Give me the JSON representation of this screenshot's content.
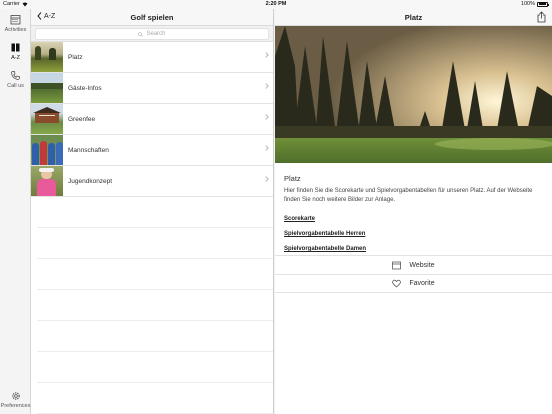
{
  "status_bar": {
    "carrier": "Carrier",
    "time": "2:20 PM",
    "battery": "100%"
  },
  "rail": {
    "items": [
      {
        "label": "Activities",
        "icon": "calendar-icon"
      },
      {
        "label": "A-Z",
        "icon": "book-icon"
      },
      {
        "label": "Call us",
        "icon": "phone-icon"
      }
    ],
    "bottom": {
      "label": "Preferences",
      "icon": "gear-icon"
    }
  },
  "list_pane": {
    "back_label": "A-Z",
    "title": "Golf spielen",
    "search_placeholder": "Search",
    "items": [
      {
        "label": "Platz"
      },
      {
        "label": "Gäste-Infos"
      },
      {
        "label": "Greenfee"
      },
      {
        "label": "Mannschaften"
      },
      {
        "label": "Jugendkonzept"
      }
    ]
  },
  "detail": {
    "title": "Platz",
    "heading": "Platz",
    "body": "Hier finden Sie die Scorekarte und Spielvorgabentabellen für unseren Platz. Auf der Webseite finden Sie noch weitere Bilder zur Anlage.",
    "links": [
      "Scorekarte",
      "Spielvorgabentabelle Herren",
      "Spielvorgabentabelle Damen"
    ],
    "actions": [
      {
        "label": "Website",
        "icon": "calendar-icon"
      },
      {
        "label": "Favorite",
        "icon": "heart-icon"
      }
    ]
  }
}
